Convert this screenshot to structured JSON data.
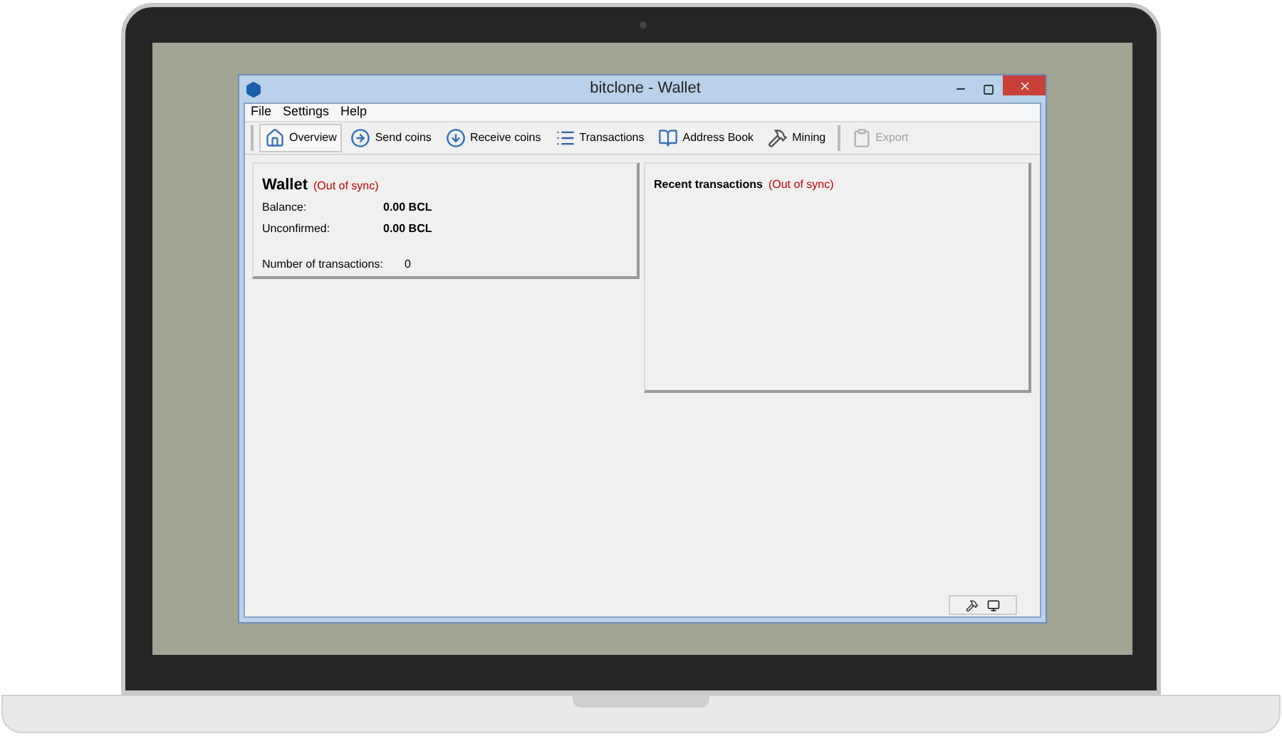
{
  "window": {
    "title": "bitclone - Wallet"
  },
  "menu": [
    "File",
    "Settings",
    "Help"
  ],
  "toolbar": [
    {
      "label": "Overview",
      "selected": true,
      "disabled": false
    },
    {
      "label": "Send coins",
      "selected": false,
      "disabled": false
    },
    {
      "label": "Receive coins",
      "selected": false,
      "disabled": false
    },
    {
      "label": "Transactions",
      "selected": false,
      "disabled": false
    },
    {
      "label": "Address Book",
      "selected": false,
      "disabled": false
    },
    {
      "label": "Mining",
      "selected": false,
      "disabled": false
    },
    {
      "label": "Export",
      "selected": false,
      "disabled": true
    }
  ],
  "wallet": {
    "title": "Wallet",
    "sync_status": "(Out of sync)",
    "rows": [
      {
        "label": "Balance:",
        "value": "0.00 BCL",
        "bold": true
      },
      {
        "label": "Unconfirmed:",
        "value": "0.00 BCL",
        "bold": true
      },
      {
        "label": "Number of transactions:",
        "value": "0",
        "bold": false
      }
    ]
  },
  "recent": {
    "title": "Recent transactions",
    "sync_status": "(Out of sync)"
  }
}
